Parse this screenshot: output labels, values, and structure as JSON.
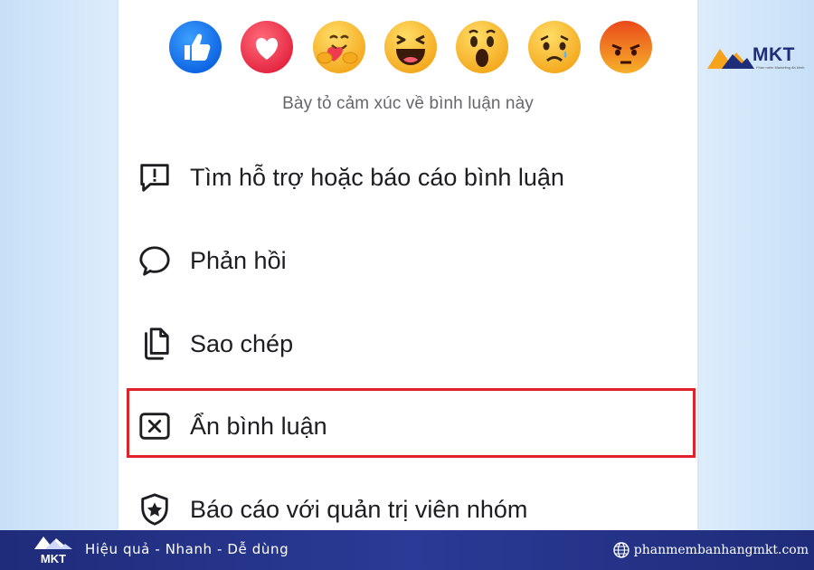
{
  "reactions": [
    {
      "name": "like",
      "icon": "thumbs-up-icon"
    },
    {
      "name": "love",
      "icon": "heart-icon"
    },
    {
      "name": "care",
      "icon": "hugging-face-icon"
    },
    {
      "name": "haha",
      "icon": "laughing-face-icon"
    },
    {
      "name": "wow",
      "icon": "surprised-face-icon"
    },
    {
      "name": "sad",
      "icon": "sad-face-icon"
    },
    {
      "name": "angry",
      "icon": "angry-face-icon"
    }
  ],
  "reaction_caption": "Bày tỏ cảm xúc về bình luận này",
  "menu": {
    "items": [
      {
        "label": "Tìm hỗ trợ hoặc báo cáo bình luận",
        "icon": "report-message-icon"
      },
      {
        "label": "Phản hồi",
        "icon": "speech-bubble-icon"
      },
      {
        "label": "Sao chép",
        "icon": "copy-icon"
      },
      {
        "label": "Ẩn bình luận",
        "icon": "hide-x-icon",
        "highlighted": true
      },
      {
        "label": "Báo cáo với quản trị viên nhóm",
        "icon": "shield-star-icon"
      }
    ]
  },
  "brand": {
    "name": "MKT",
    "tagline": "Phần mềm Marketing đa kênh"
  },
  "footer": {
    "logo_text": "MKT",
    "slogan": "Hiệu quả - Nhanh - Dễ dùng",
    "website": "phanmembanhangmkt.com"
  },
  "colors": {
    "highlight": "#e0232b",
    "footer_bg": "#1f2c7a",
    "brand_orange": "#f7a21b",
    "brand_blue": "#1f2c7a"
  }
}
